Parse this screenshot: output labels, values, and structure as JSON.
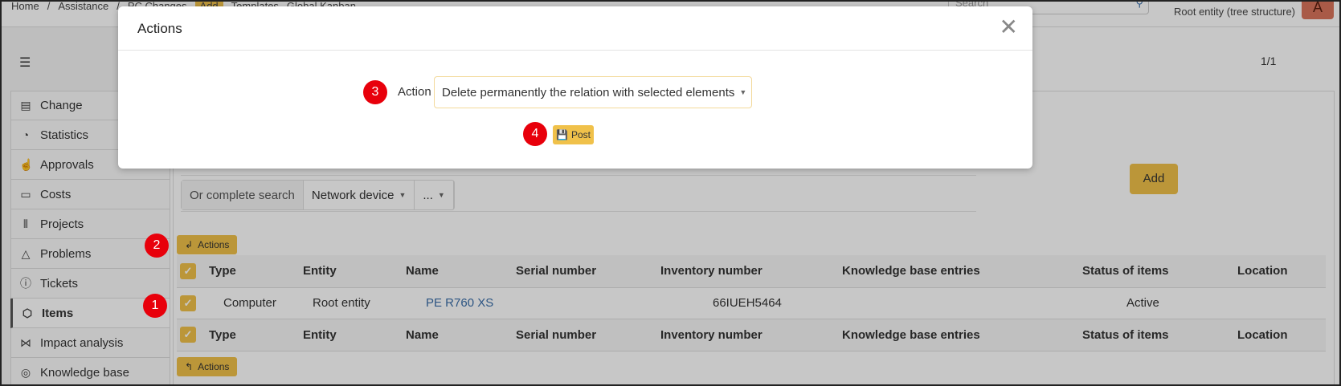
{
  "topbar": {
    "crumbs": [
      "Home",
      "/",
      "Assistance",
      "/",
      "PC Changes",
      "Add",
      "Templates",
      "Global Kanban"
    ],
    "search_placeholder": "Search",
    "root_entity": "Root entity (tree structure)",
    "avatar_letter": "A"
  },
  "pager": "1/1",
  "sidebar": {
    "items": [
      {
        "label": "Change",
        "icon": "clipboard-check-icon"
      },
      {
        "label": "Statistics",
        "icon": "pie-chart-icon"
      },
      {
        "label": "Approvals",
        "icon": "thumbs-up-icon"
      },
      {
        "label": "Costs",
        "icon": "money-icon"
      },
      {
        "label": "Projects",
        "icon": "projects-icon"
      },
      {
        "label": "Problems",
        "icon": "warning-icon"
      },
      {
        "label": "Tickets",
        "icon": "alert-circle-icon"
      },
      {
        "label": "Items",
        "icon": "package-icon"
      },
      {
        "label": "Impact analysis",
        "icon": "graph-icon"
      },
      {
        "label": "Knowledge base",
        "icon": "lifebuoy-icon"
      }
    ]
  },
  "search": {
    "complete_label": "Or complete search",
    "type_value": "Network device",
    "more_value": "..."
  },
  "add_label": "Add",
  "actions_label": "Actions",
  "table": {
    "headers": [
      "Type",
      "Entity",
      "Name",
      "Serial number",
      "Inventory number",
      "Knowledge base entries",
      "Status of items",
      "Location"
    ],
    "rows": [
      {
        "type": "Computer",
        "entity": "Root entity",
        "name": "PE R760 XS",
        "serial": "",
        "inventory": "66IUEH5464",
        "kb": "",
        "status": "Active",
        "location": ""
      }
    ]
  },
  "modal": {
    "title": "Actions",
    "action_label": "Action",
    "action_value": "Delete permanently the relation with selected elements",
    "post_label": "Post"
  },
  "markers": [
    "1",
    "2",
    "3",
    "4"
  ],
  "colors": {
    "accent": "#f0c14a",
    "marker": "#e8000b",
    "link": "#3a6ea8"
  }
}
